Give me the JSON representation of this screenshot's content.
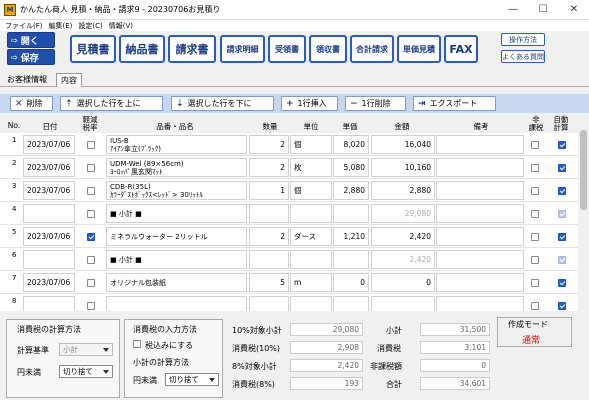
{
  "window": {
    "app_icon": "M",
    "title": "かんたん商人 見積・納品・請求9 - 20230706お見積り"
  },
  "menu": [
    {
      "label": "ファイル(F)"
    },
    {
      "label": "編集(E)"
    },
    {
      "label": "設定(C)"
    },
    {
      "label": "情報(V)"
    }
  ],
  "toolbar": {
    "open_label": "開く",
    "save_label": "保存",
    "docs": [
      "見積書",
      "納品書",
      "請求書",
      "請求明細",
      "受領書",
      "領収書",
      "合計請求",
      "単価見積",
      "FAX"
    ],
    "help": [
      "操作方法",
      "よくある質問"
    ]
  },
  "tabs": [
    {
      "label": "お客様情報"
    },
    {
      "label": "内容"
    }
  ],
  "actions": [
    {
      "icon": "✕",
      "label": "削除"
    },
    {
      "icon": "⇡",
      "label": "選択した行を上に"
    },
    {
      "icon": "⇣",
      "label": "選択した行を下に"
    },
    {
      "icon": "+",
      "label": "1行挿入"
    },
    {
      "icon": "−",
      "label": "1行削除"
    },
    {
      "icon": "⇥",
      "label": "エクスポート"
    }
  ],
  "columns": {
    "no": "No.",
    "date": "日付",
    "reduced": "軽減\n税率",
    "name": "品番・品名",
    "qty": "数量",
    "unit": "単位",
    "price": "単価",
    "amount": "金額",
    "memo": "備考",
    "nontax": "非\n課税",
    "auto": "自動\n計算"
  },
  "rows": [
    {
      "no": "1",
      "date": "2023/07/06",
      "reduced": false,
      "code": "IUS-B",
      "name": "ｱｲｱﾝ傘立(ﾌﾞﾗｯｸ)",
      "qty": "2",
      "unit": "個",
      "price": "8,020",
      "amount": "16,040",
      "amount_dim": false,
      "nontax": false,
      "auto": true,
      "auto_dis": false
    },
    {
      "no": "2",
      "date": "2023/07/06",
      "reduced": false,
      "code": "UDM-Wel (89×56cm)",
      "name": "ﾖｰﾛｯﾊﾟ風玄関ﾏｯﾄ",
      "qty": "2",
      "unit": "枚",
      "price": "5,080",
      "amount": "10,160",
      "amount_dim": false,
      "nontax": false,
      "auto": true,
      "auto_dis": false
    },
    {
      "no": "3",
      "date": "2023/07/06",
      "reduced": false,
      "code": "CDB-R(35L)",
      "name": "ｶﾗｰﾀﾞｽﾄﾎﾞｯｸｽ<ﾚｯﾄﾞ> 30ﾘｯﾄﾙ",
      "qty": "1",
      "unit": "個",
      "price": "2,880",
      "amount": "2,880",
      "amount_dim": false,
      "nontax": false,
      "auto": true,
      "auto_dis": false
    },
    {
      "no": "4",
      "date": "",
      "reduced": false,
      "code": "",
      "name": "■ 小計 ■",
      "qty": "",
      "unit": "",
      "price": "",
      "amount": "29,080",
      "amount_dim": true,
      "nontax": false,
      "auto": true,
      "auto_dis": true
    },
    {
      "no": "5",
      "date": "2023/07/06",
      "reduced": true,
      "code": "",
      "name": "ミネラルウォーター 2リットル",
      "qty": "2",
      "unit": "ダース",
      "price": "1,210",
      "amount": "2,420",
      "amount_dim": false,
      "nontax": false,
      "auto": true,
      "auto_dis": false
    },
    {
      "no": "6",
      "date": "",
      "reduced": false,
      "code": "",
      "name": "■ 小計 ■",
      "qty": "",
      "unit": "",
      "price": "",
      "amount": "2,420",
      "amount_dim": true,
      "nontax": false,
      "auto": true,
      "auto_dis": true
    },
    {
      "no": "7",
      "date": "2023/07/06",
      "reduced": false,
      "code": "",
      "name": "オリジナル包装紙",
      "qty": "5",
      "unit": "m",
      "price": "0",
      "amount": "0",
      "amount_dim": false,
      "nontax": false,
      "auto": true,
      "auto_dis": false
    },
    {
      "no": "8",
      "date": "",
      "reduced": false,
      "code": "",
      "name": "",
      "qty": "",
      "unit": "",
      "price": "",
      "amount": "",
      "amount_dim": false,
      "nontax": false,
      "auto": true,
      "auto_dis": false
    }
  ],
  "tax_calc": {
    "title": "消費税の計算方法",
    "basis_label": "計算基準",
    "basis_value": "小計",
    "round_label": "円未満",
    "round_value": "切り捨て"
  },
  "tax_input": {
    "title": "消費税の入力方法",
    "checkbox_label": "税込みにする",
    "subtotal_title": "小計の計算方法",
    "round_label": "円未満",
    "round_value": "切り捨て"
  },
  "totals": [
    {
      "label": "10%対象小計",
      "value": "29,080"
    },
    {
      "label": "消費税(10%)",
      "value": "2,908"
    },
    {
      "label": "8%対象小計",
      "value": "2,420"
    },
    {
      "label": "消費税(8%)",
      "value": "193"
    }
  ],
  "totals2": [
    {
      "label": "小計",
      "value": "31,500"
    },
    {
      "label": "消費税",
      "value": "3,101"
    },
    {
      "label": "非課税額",
      "value": "0"
    },
    {
      "label": "合計",
      "value": "34,601"
    }
  ],
  "mode": {
    "label": "作成モード",
    "value": "通常",
    "value_color": "#e00000"
  }
}
